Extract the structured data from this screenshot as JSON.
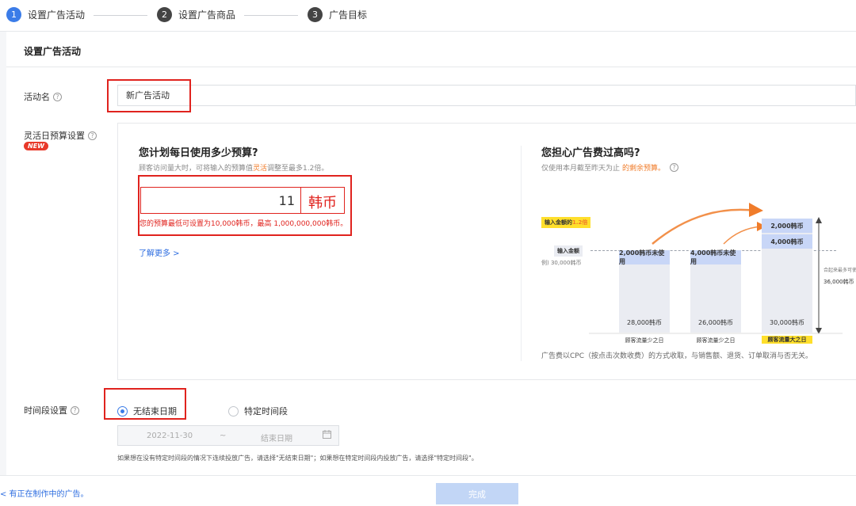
{
  "steps": [
    {
      "num": "1",
      "label": "设置广告活动"
    },
    {
      "num": "2",
      "label": "设置广告商品"
    },
    {
      "num": "3",
      "label": "广告目标"
    }
  ],
  "card": {
    "title": "设置广告活动"
  },
  "campaign_name": {
    "label": "活动名",
    "value": "新广告活动"
  },
  "budget": {
    "label": "灵活日预算设置",
    "badge": "NEW",
    "title": "您计划每日使用多少预算?",
    "sub_prefix": "顾客访问量大时，可将输入的预算值",
    "sub_highlight": "灵活",
    "sub_suffix": "调整至最多1.2倍。",
    "amount": "11",
    "unit": "韩币",
    "error": "您的预算最低可设置为10,000韩币，最高 1,000,000,000韩币。",
    "learn_more": "了解更多 >"
  },
  "worry": {
    "title": "您担心广告费过高吗?",
    "sub": "仅使用本月截至昨天为止",
    "sub_highlight": "的剩余预算。",
    "footnote": "广告费以CPC（按点击次数收费）的方式收取，与销售额、退货、订单取消与否无关。",
    "illustration": {
      "tag_max_prefix": "输入金额的",
      "tag_max_highlight": "1.2倍",
      "tag_input": "输入金额",
      "example": "例) 30,000韩币",
      "bars": [
        {
          "top": "2,000韩币未使用",
          "bottom": "28,000韩币",
          "label": "顾客流量少之日"
        },
        {
          "top": "4,000韩币未使用",
          "bottom": "26,000韩币",
          "label": "顾客流量少之日"
        },
        {
          "top1": "2,000韩币",
          "top2": "4,000韩币",
          "bottom": "30,000韩币",
          "label": "顾客流量大之日"
        }
      ],
      "side_note1": "合起来最多可使用",
      "side_note2": "36,000韩币"
    }
  },
  "schedule": {
    "label": "时间段设置",
    "option_no_end": "无结束日期",
    "option_specific": "特定时间段",
    "start_date": "2022-11-30",
    "separator": "~",
    "end_placeholder": "结束日期",
    "help": "如果想在没有特定时间段的情况下连续投放广告，请选择\"无结束日期\"；如果想在特定时间段内投放广告，请选择\"特定时间段\"。"
  },
  "footer": {
    "link": "< 有正在制作中的广告。",
    "done": "完成"
  }
}
